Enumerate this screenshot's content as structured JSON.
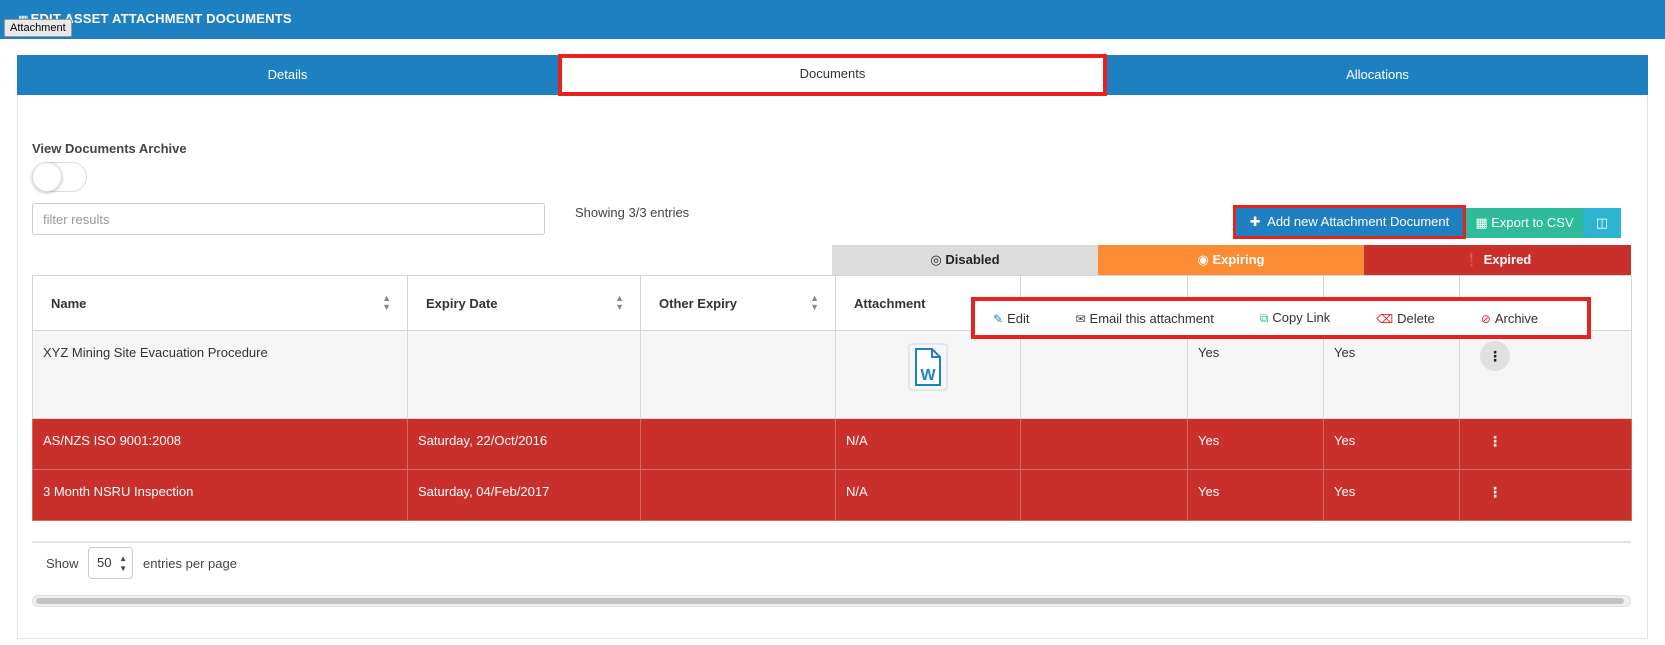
{
  "header": {
    "title": "EDIT ASSET ATTACHMENT DOCUMENTS",
    "tooltip": "Attachment"
  },
  "tabs": [
    {
      "label": "Details",
      "active": false
    },
    {
      "label": "Documents",
      "active": true
    },
    {
      "label": "Allocations",
      "active": false
    }
  ],
  "archive": {
    "label": "View Documents Archive",
    "toggle_on": false
  },
  "filter": {
    "placeholder": "filter results",
    "value": ""
  },
  "showing_text": "Showing 3/3 entries",
  "toolbar": {
    "add_label": "Add new Attachment Document",
    "export_label": "Export to CSV"
  },
  "legend": {
    "disabled": "Disabled",
    "expiring": "Expiring",
    "expired": "Expired"
  },
  "table": {
    "columns": [
      "Name",
      "Expiry Date",
      "Other Expiry",
      "Attachment",
      "",
      "",
      "",
      ""
    ],
    "rows": [
      {
        "name": "XYZ Mining Site Evacuation Procedure",
        "expiry": "",
        "other": "",
        "attachment": "",
        "c5": "",
        "c6": "Yes",
        "c7": "Yes",
        "status": "normal"
      },
      {
        "name": "AS/NZS ISO 9001:2008",
        "expiry": "Saturday, 22/Oct/2016",
        "other": "",
        "attachment": "N/A",
        "c5": "",
        "c6": "Yes",
        "c7": "Yes",
        "status": "expired"
      },
      {
        "name": "3 Month NSRU Inspection",
        "expiry": "Saturday, 04/Feb/2017",
        "other": "",
        "attachment": "N/A",
        "c5": "",
        "c6": "Yes",
        "c7": "Yes",
        "status": "expired"
      }
    ]
  },
  "context_menu": {
    "edit": "Edit",
    "email": "Email this attachment",
    "copy": "Copy Link",
    "delete": "Delete",
    "archive": "Archive"
  },
  "pagination": {
    "show_label": "Show",
    "page_size": "50",
    "per_page_label": "entries per page"
  },
  "colors": {
    "primary": "#1e80c1",
    "highlight_border": "#e8231f",
    "expiring": "#fb8c34",
    "expired": "#c9302c",
    "disabled": "#dcdcdc",
    "csv": "#2dbb9a"
  }
}
